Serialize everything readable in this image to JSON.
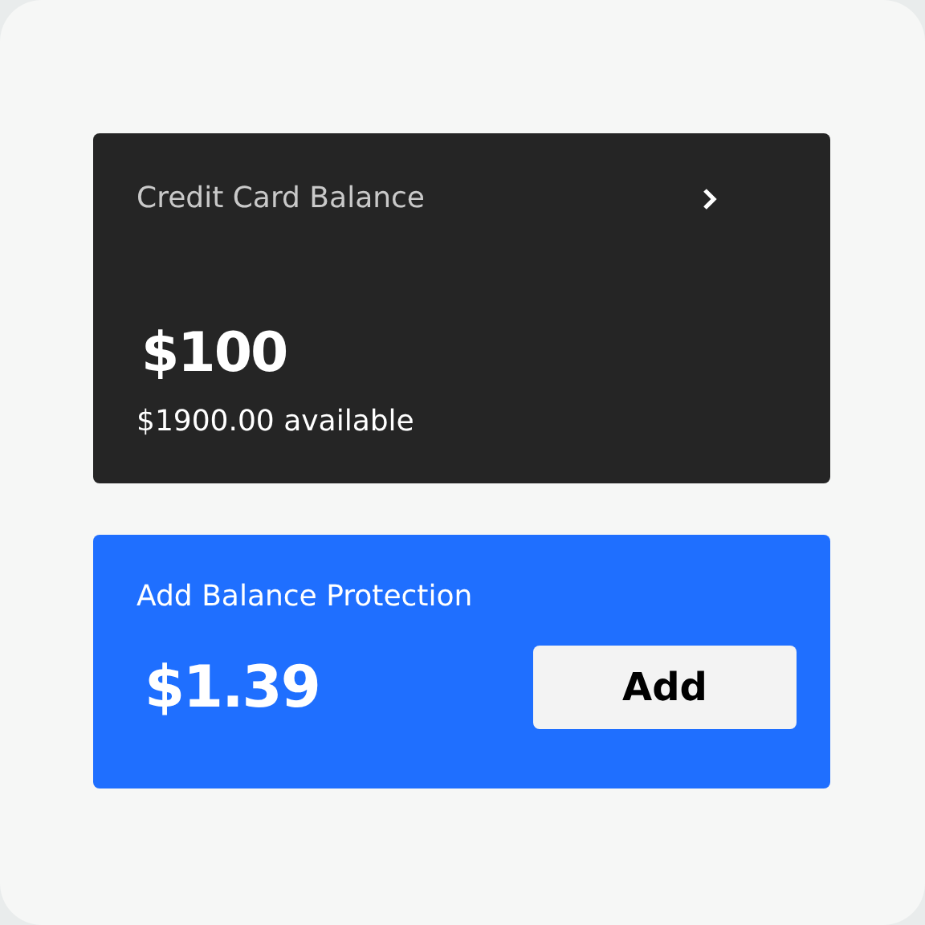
{
  "balance_card": {
    "title": "Credit Card Balance",
    "amount": "$100",
    "available": "$1900.00 available"
  },
  "protection_card": {
    "title": "Add Balance Protection",
    "price": "$1.39",
    "button": "Add"
  }
}
